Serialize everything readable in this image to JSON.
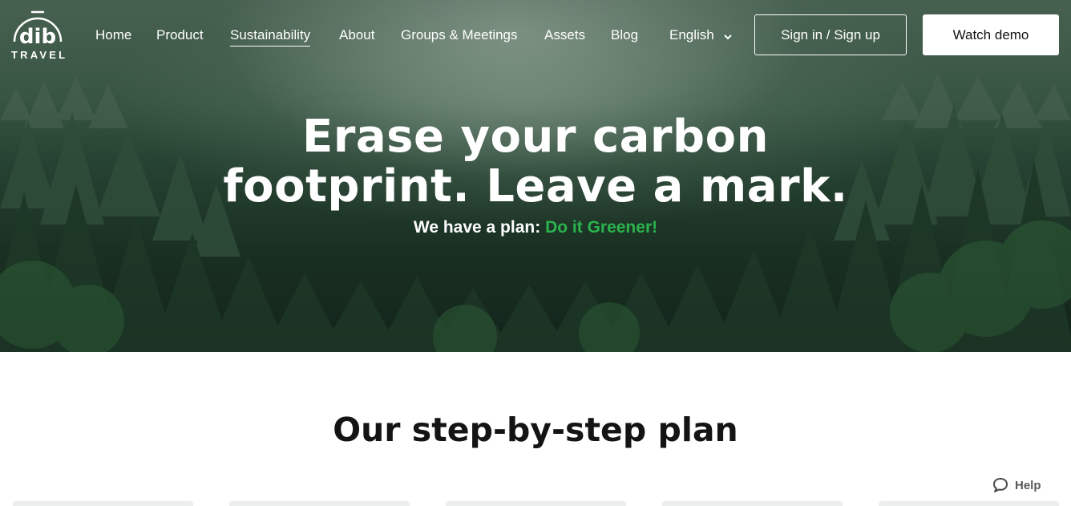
{
  "brand": {
    "logo_mark": "dib",
    "logo_text": "TRAVEL"
  },
  "nav": {
    "items": [
      {
        "label": "Home",
        "active": false
      },
      {
        "label": "Product",
        "active": false
      },
      {
        "label": "Sustainability",
        "active": true
      },
      {
        "label": "About",
        "active": false
      },
      {
        "label": "Groups & Meetings",
        "active": false
      },
      {
        "label": "Assets",
        "active": false
      },
      {
        "label": "Blog",
        "active": false
      }
    ],
    "language": {
      "label": "English",
      "icon": "chevron-down-icon"
    },
    "signin_label": "Sign in / Sign up",
    "demo_label": "Watch demo"
  },
  "hero": {
    "headline_line1": "Erase your carbon",
    "headline_line2": "footprint. Leave a mark.",
    "sub_prefix": "We have a plan:",
    "sub_accent": "Do it Greener!",
    "accent_color": "#2bb34d"
  },
  "plan": {
    "title": "Our step-by-step plan"
  },
  "help": {
    "label": "Help",
    "icon": "chat-bubble-icon"
  }
}
